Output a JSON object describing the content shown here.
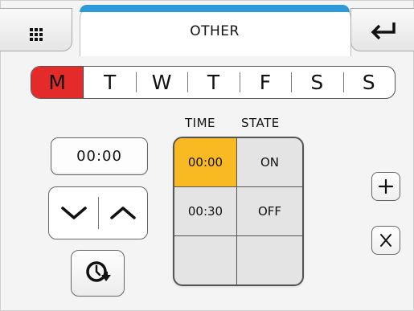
{
  "header": {
    "title": "OTHER",
    "menu_icon": "grid-icon",
    "back_icon": "enter-return-icon",
    "accent_color": "#2e9ad9"
  },
  "days": {
    "items": [
      "M",
      "T",
      "W",
      "T",
      "F",
      "S",
      "S"
    ],
    "selected_index": 0,
    "selected_color": "#e52a2a"
  },
  "controls": {
    "time_value": "00:00",
    "down_icon": "chevron-down-icon",
    "up_icon": "chevron-up-icon",
    "timer_icon": "clock-arrow-icon"
  },
  "schedule": {
    "headers": {
      "time": "TIME",
      "state": "STATE"
    },
    "rows": [
      {
        "time": "00:00",
        "state": "ON"
      },
      {
        "time": "00:30",
        "state": "OFF"
      },
      {
        "time": "",
        "state": ""
      }
    ],
    "selected_row": 0,
    "selected_color": "#f9b922"
  },
  "side_buttons": {
    "add_icon": "plus-icon",
    "delete_icon": "x-icon"
  }
}
